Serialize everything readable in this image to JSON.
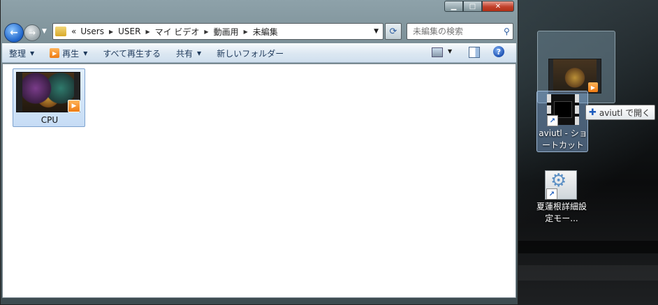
{
  "address_bar": {
    "overflow_label": "«",
    "crumbs": [
      "Users",
      "USER",
      "マイ ビデオ",
      "動画用",
      "未編集"
    ]
  },
  "search": {
    "placeholder": "未編集の検索"
  },
  "toolbar": {
    "organize": "整理",
    "play": "再生",
    "play_all": "すべて再生する",
    "share": "共有",
    "new_folder": "新しいフォルダー"
  },
  "files": [
    {
      "name": "CPU",
      "icon": "video-thumbnail"
    }
  ],
  "desktop": {
    "shortcut_label": "aviutl - ショートカット",
    "tooltip": "aviutl で開く",
    "settings_label": "夏蓮根詳細設定モー..."
  },
  "icons": {
    "back": "back-arrow-icon",
    "forward": "forward-arrow-icon",
    "folder": "folder-icon",
    "refresh": "refresh-icon",
    "search": "search-icon",
    "help": "help-icon"
  },
  "colors": {
    "selection": "#c6dcf5",
    "toolbar_text": "#1e395b",
    "close_button": "#c1402b"
  }
}
